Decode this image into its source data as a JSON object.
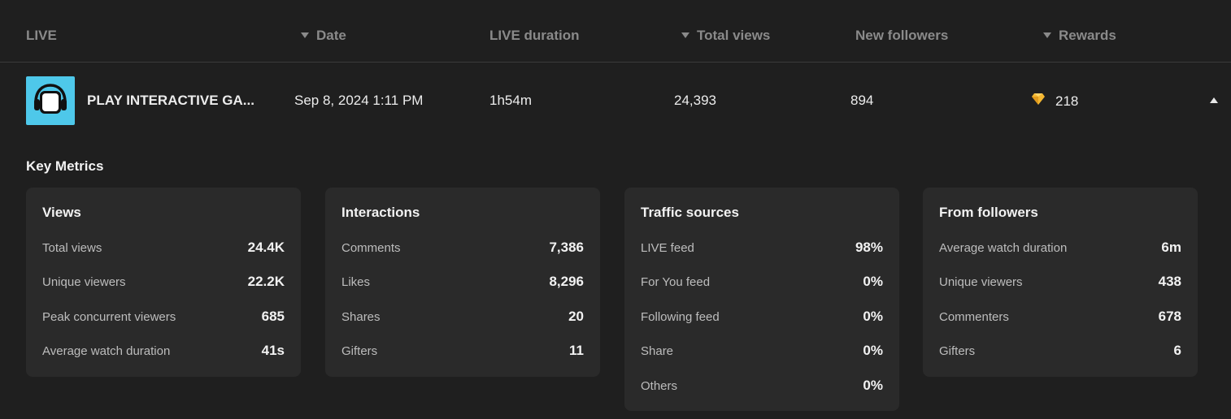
{
  "table": {
    "headers": [
      {
        "label": "LIVE",
        "sortable": false
      },
      {
        "label": "Date",
        "sortable": true
      },
      {
        "label": "LIVE duration",
        "sortable": false
      },
      {
        "label": "Total views",
        "sortable": true
      },
      {
        "label": "New followers",
        "sortable": false
      },
      {
        "label": "Rewards",
        "sortable": true
      }
    ],
    "row": {
      "thumbnail_icon": "headphones-icon",
      "title": "PLAY INTERACTIVE GA...",
      "date": "Sep 8, 2024 1:11 PM",
      "duration": "1h54m",
      "total_views": "24,393",
      "new_followers": "894",
      "rewards_icon": "gem-icon",
      "rewards": "218",
      "expand_icon": "chevron-up-icon"
    }
  },
  "key_metrics": {
    "title": "Key Metrics",
    "cards": [
      {
        "title": "Views",
        "metrics": [
          {
            "label": "Total views",
            "value": "24.4K"
          },
          {
            "label": "Unique viewers",
            "value": "22.2K"
          },
          {
            "label": "Peak concurrent viewers",
            "value": "685"
          },
          {
            "label": "Average watch duration",
            "value": "41s"
          }
        ]
      },
      {
        "title": "Interactions",
        "metrics": [
          {
            "label": "Comments",
            "value": "7,386"
          },
          {
            "label": "Likes",
            "value": "8,296"
          },
          {
            "label": "Shares",
            "value": "20"
          },
          {
            "label": "Gifters",
            "value": "11"
          }
        ]
      },
      {
        "title": "Traffic sources",
        "metrics": [
          {
            "label": "LIVE feed",
            "value": "98%"
          },
          {
            "label": "For You feed",
            "value": "0%"
          },
          {
            "label": "Following feed",
            "value": "0%"
          },
          {
            "label": "Share",
            "value": "0%"
          },
          {
            "label": "Others",
            "value": "0%"
          }
        ]
      },
      {
        "title": "From followers",
        "metrics": [
          {
            "label": "Average watch duration",
            "value": "6m"
          },
          {
            "label": "Unique viewers",
            "value": "438"
          },
          {
            "label": "Commenters",
            "value": "678"
          },
          {
            "label": "Gifters",
            "value": "6"
          }
        ]
      }
    ]
  },
  "colors": {
    "background": "#1f1f1f",
    "card": "#2a2a2a",
    "thumbnail": "#4ec8ea",
    "gem": "#f5b731"
  }
}
